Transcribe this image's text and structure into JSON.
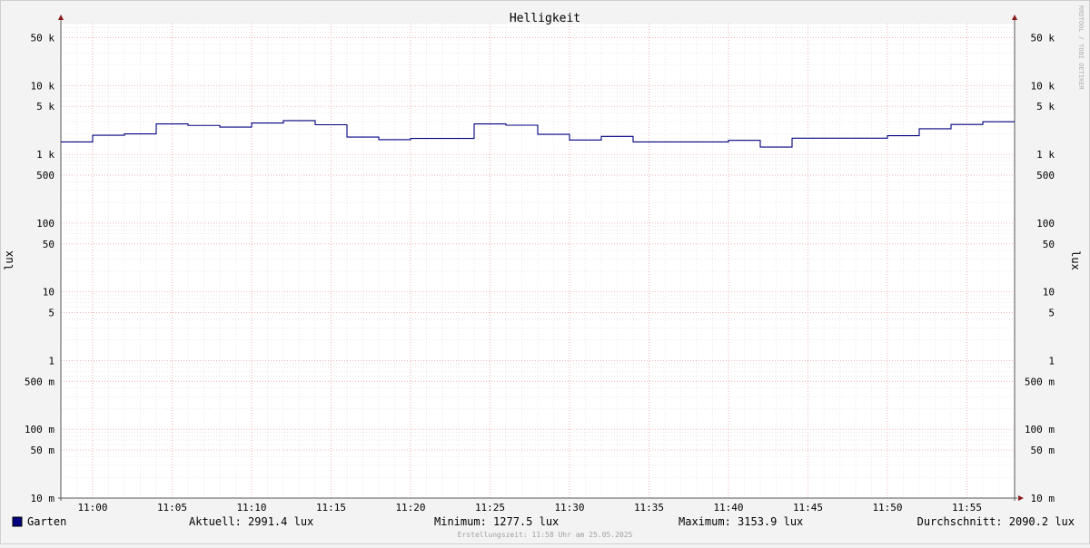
{
  "chart_data": {
    "type": "line",
    "title": "Helligkeit",
    "ylabel_left": "lux",
    "ylabel_right": "lux",
    "y_scale": "log",
    "ylim": [
      0.01,
      80000
    ],
    "x_unit": "time of day (HH:MM)",
    "xlim": [
      "10:58",
      "11:58"
    ],
    "y_ticks": [
      {
        "value": 50000,
        "label": "50 k"
      },
      {
        "value": 10000,
        "label": "10 k"
      },
      {
        "value": 5000,
        "label": "5 k"
      },
      {
        "value": 1000,
        "label": "1 k"
      },
      {
        "value": 500,
        "label": "500"
      },
      {
        "value": 100,
        "label": "100"
      },
      {
        "value": 50,
        "label": "50"
      },
      {
        "value": 10,
        "label": "10"
      },
      {
        "value": 5,
        "label": "5"
      },
      {
        "value": 1,
        "label": "1"
      },
      {
        "value": 0.5,
        "label": "500 m"
      },
      {
        "value": 0.1,
        "label": "100 m"
      },
      {
        "value": 0.05,
        "label": "50 m"
      },
      {
        "value": 0.01,
        "label": "10 m"
      }
    ],
    "x_ticks": [
      "11:00",
      "11:05",
      "11:10",
      "11:15",
      "11:20",
      "11:25",
      "11:30",
      "11:35",
      "11:40",
      "11:45",
      "11:50",
      "11:55"
    ],
    "grid": true,
    "series": [
      {
        "name": "Garten",
        "color": "#000080",
        "step": true,
        "x": [
          "10:58",
          "11:00",
          "11:02",
          "11:04",
          "11:06",
          "11:08",
          "11:10",
          "11:12",
          "11:14",
          "11:16",
          "11:18",
          "11:20",
          "11:22",
          "11:24",
          "11:26",
          "11:28",
          "11:30",
          "11:32",
          "11:34",
          "11:36",
          "11:38",
          "11:40",
          "11:42",
          "11:44",
          "11:46",
          "11:48",
          "11:50",
          "11:52",
          "11:54",
          "11:56"
        ],
        "values": [
          1520,
          1900,
          1990,
          2780,
          2640,
          2500,
          2860,
          3100,
          2700,
          1790,
          1640,
          1710,
          1710,
          2780,
          2660,
          1960,
          1620,
          1830,
          1520,
          1520,
          1520,
          1600,
          1280,
          1720,
          1720,
          1720,
          1870,
          2360,
          2730,
          2990
        ]
      }
    ]
  },
  "legend": {
    "series_label": "Garten",
    "swatch_color": "#000080",
    "current": "Aktuell: 2991.4 lux",
    "minimum": "Minimum: 1277.5 lux",
    "maximum": "Maximum: 3153.9 lux",
    "average": "Durchschnitt: 2090.2 lux"
  },
  "footer": "Erstellungszeit: 11:58 Uhr am 25.05.2025",
  "watermark": "RRDTOOL / TOBI OETIKER"
}
